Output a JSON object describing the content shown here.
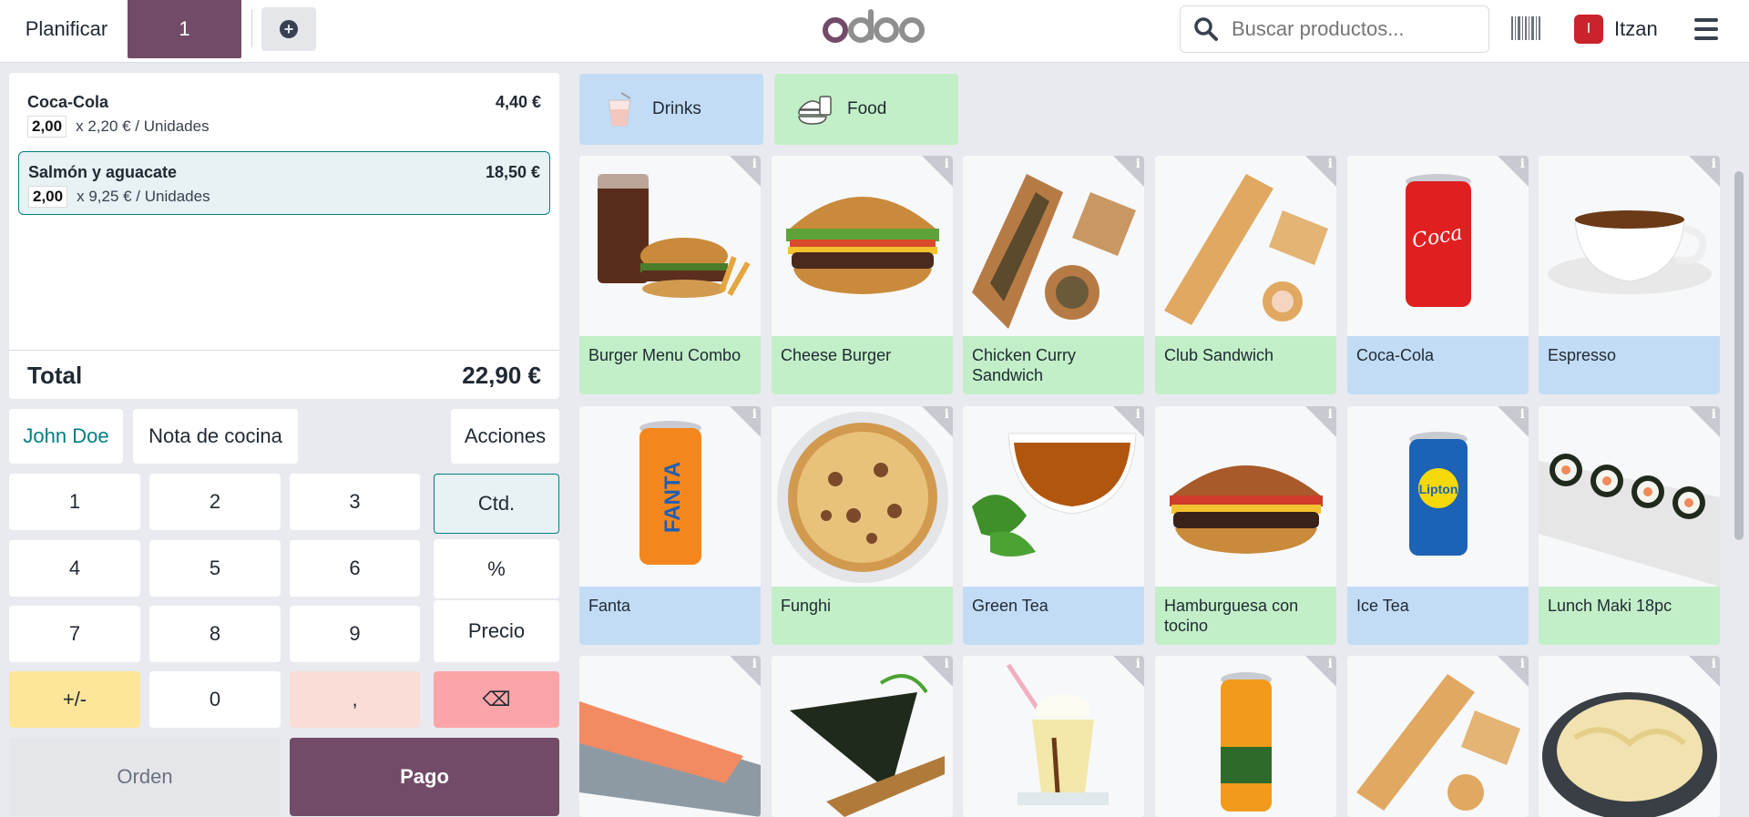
{
  "header": {
    "plan_label": "Planificar",
    "order_tab": "1",
    "logo_text": "odoo",
    "search_placeholder": "Buscar productos...",
    "user_initial": "I",
    "user_name": "Itzan"
  },
  "order": {
    "lines": [
      {
        "name": "Coca-Cola",
        "price": "4,40 €",
        "qty": "2,00",
        "unit_text": "x 2,20 € / Unidades",
        "selected": false
      },
      {
        "name": "Salmón y aguacate",
        "price": "18,50 €",
        "qty": "2,00",
        "unit_text": "x 9,25 € / Unidades",
        "selected": true
      }
    ],
    "total_label": "Total",
    "total_value": "22,90 €"
  },
  "controls": {
    "customer": "John Doe",
    "note": "Nota de cocina",
    "actions": "Acciones"
  },
  "numpad": {
    "k1": "1",
    "k2": "2",
    "k3": "3",
    "k4": "4",
    "k5": "5",
    "k6": "6",
    "k7": "7",
    "k8": "8",
    "k9": "9",
    "sign": "+/-",
    "k0": "0",
    "comma": ",",
    "qty_mode": "Ctd.",
    "disc_mode": "%",
    "price_mode": "Precio",
    "backspace": "⌫"
  },
  "footer": {
    "order_btn": "Orden",
    "pay_btn": "Pago"
  },
  "categories": [
    {
      "name": "Drinks",
      "color": "#c3dcf5"
    },
    {
      "name": "Food",
      "color": "#c2efc7"
    }
  ],
  "products": [
    {
      "name": "Burger Menu Combo",
      "category": "food"
    },
    {
      "name": "Cheese Burger",
      "category": "food"
    },
    {
      "name": "Chicken Curry Sandwich",
      "category": "food"
    },
    {
      "name": "Club Sandwich",
      "category": "food"
    },
    {
      "name": "Coca-Cola",
      "category": "drink"
    },
    {
      "name": "Espresso",
      "category": "drink"
    },
    {
      "name": "Fanta",
      "category": "drink"
    },
    {
      "name": "Funghi",
      "category": "food"
    },
    {
      "name": "Green Tea",
      "category": "drink"
    },
    {
      "name": "Hamburguesa con tocino",
      "category": "food"
    },
    {
      "name": "Ice Tea",
      "category": "drink"
    },
    {
      "name": "Lunch Maki 18pc",
      "category": "food"
    }
  ],
  "colors": {
    "accent": "#714b67",
    "teal": "#017e84",
    "drink": "#c3dcf5",
    "food": "#c2efc7"
  }
}
